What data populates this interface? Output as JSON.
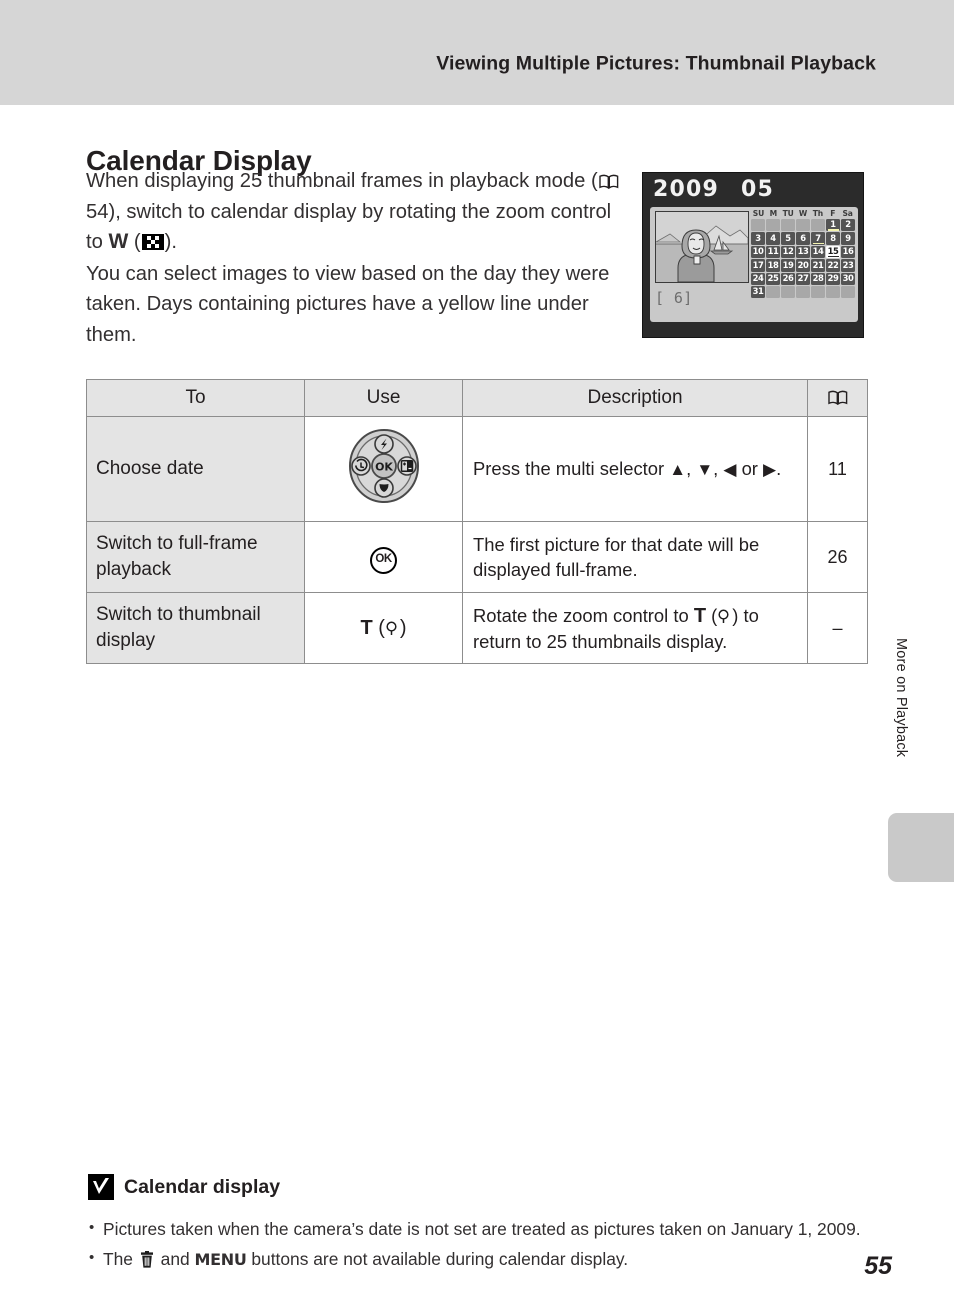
{
  "header": {
    "title": "Viewing Multiple Pictures: Thumbnail Playback"
  },
  "section": {
    "title": "Calendar Display",
    "paragraph1_a": "When displaying 25 thumbnail frames in playback mode (",
    "paragraph1_ref": "54",
    "paragraph1_b": "), switch to calendar display by rotating the zoom control to ",
    "paragraph1_w": "W",
    "paragraph1_c": "(",
    "paragraph1_d": ").",
    "paragraph2": "You can select images to view based on the day they were taken. Days containing pictures have a yellow line under them."
  },
  "monitor": {
    "year": "2009",
    "month": "05",
    "frame_count": "[   6]",
    "dow": [
      "SU",
      "M",
      "TU",
      "W",
      "Th",
      "F",
      "Sa"
    ],
    "weeks": [
      [
        null,
        null,
        null,
        null,
        null,
        1,
        2
      ],
      [
        3,
        4,
        5,
        6,
        7,
        8,
        9
      ],
      [
        10,
        11,
        12,
        13,
        14,
        15,
        16
      ],
      [
        17,
        18,
        19,
        20,
        21,
        22,
        23
      ],
      [
        24,
        25,
        26,
        27,
        28,
        29,
        30
      ],
      [
        31,
        null,
        null,
        null,
        null,
        null,
        null
      ]
    ],
    "selected_day": 15,
    "marked_days": [
      1,
      7,
      15
    ]
  },
  "table": {
    "headers": {
      "to": "To",
      "use": "Use",
      "description": "Description",
      "reference_icon": "book-icon"
    },
    "rows": [
      {
        "to": "Choose date",
        "use_icon": "multi-selector-icon",
        "desc_a": "Press the multi selector ",
        "desc_up": "▲",
        "desc_sep1": ", ",
        "desc_down": "▼",
        "desc_sep2": ", ",
        "desc_left": "◀",
        "desc_or": " or ",
        "desc_right": "▶",
        "desc_end": ".",
        "ref": "11"
      },
      {
        "to": "Switch to full-frame playback",
        "use_icon": "ok-button-icon",
        "use_label": "OK",
        "desc": "The first picture for that date will be displayed full-frame.",
        "ref": "26"
      },
      {
        "to": "Switch to thumbnail display",
        "use_label_t": "T",
        "use_paren_open": "(",
        "use_icon": "magnifier-icon",
        "use_paren_close": ")",
        "desc_a": "Rotate the zoom control to ",
        "desc_t": "T",
        "desc_b": "(",
        "desc_c": ") to return to 25 thumbnails display.",
        "ref": "–"
      }
    ]
  },
  "side": {
    "chapter_label": "More on Playback"
  },
  "note": {
    "icon": "caution-checkmark-icon",
    "heading": "Calendar display",
    "bullet1": "Pictures taken when the camera’s date is not set are treated as pictures taken on January 1, 2009.",
    "bullet2_a": "The ",
    "bullet2_trash": "trash-icon",
    "bullet2_b": " and ",
    "bullet2_menu": "MENU",
    "bullet2_c": " buttons are not available during calendar display."
  },
  "footer": {
    "page_number": "55"
  },
  "colors": {
    "header_band": "#d6d6d6",
    "table_header_bg": "#e4e4e4",
    "table_border": "#8d8d8d",
    "monitor_bg": "#2b2b2b",
    "calendar_panel": "#c9c9c9",
    "marker_yellow": "#f4f4b0",
    "side_tab": "#c9c9c9"
  }
}
